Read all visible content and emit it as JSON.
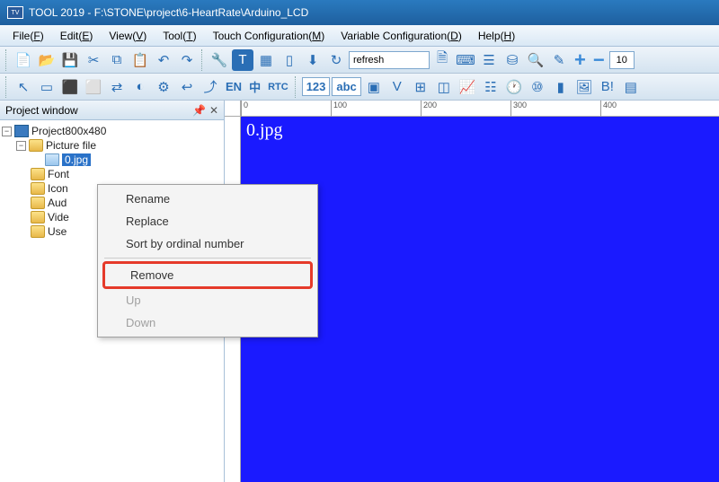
{
  "title": "TOOL 2019 - F:\\STONE\\project\\6-HeartRate\\Arduino_LCD",
  "menubar": [
    {
      "label": "File",
      "key": "F"
    },
    {
      "label": "Edit",
      "key": "E"
    },
    {
      "label": "View",
      "key": "V"
    },
    {
      "label": "Tool",
      "key": "T"
    },
    {
      "label": "Touch Configuration",
      "key": "M"
    },
    {
      "label": "Variable Configuration",
      "key": "D"
    },
    {
      "label": "Help",
      "key": "H"
    }
  ],
  "toolbar1": {
    "combo_value": "refresh",
    "spin_value": "10"
  },
  "toolbar2": {
    "en": "EN",
    "zh": "中",
    "rtc": "RTC",
    "num": "123",
    "abc": "abc"
  },
  "sidebar": {
    "title": "Project window",
    "root": "Project800x480",
    "picture_folder": "Picture file",
    "selected_file": "0.jpg",
    "folders": [
      "Font",
      "Icon",
      "Aud",
      "Vide",
      "Use"
    ]
  },
  "canvas": {
    "page_label": "0.jpg",
    "ruler_ticks": [
      "0",
      "100",
      "200",
      "300",
      "400"
    ]
  },
  "context_menu": {
    "items": [
      {
        "label": "Rename",
        "enabled": true
      },
      {
        "label": "Replace",
        "enabled": true
      },
      {
        "label": "Sort by ordinal number",
        "enabled": true
      }
    ],
    "remove": "Remove",
    "after": [
      {
        "label": "Up",
        "enabled": false
      },
      {
        "label": "Down",
        "enabled": false
      }
    ]
  }
}
